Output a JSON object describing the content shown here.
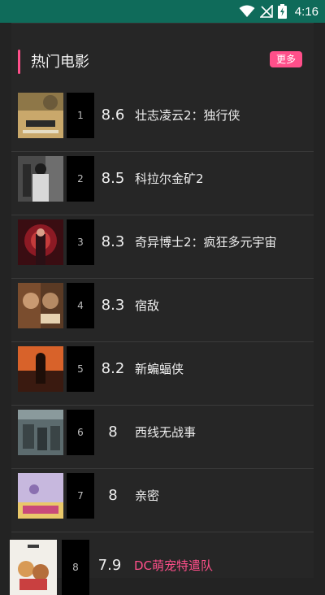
{
  "status_bar": {
    "time": "4:16",
    "icons": [
      "wifi-icon",
      "no-signal-icon",
      "battery-charging-icon"
    ],
    "background": "#0f6b5a"
  },
  "section": {
    "title": "热门电影",
    "more_label": "更多",
    "accent_color": "#ff4f8a"
  },
  "movies": [
    {
      "rank": "1",
      "score": "8.6",
      "title": "壮志凌云2：独行侠"
    },
    {
      "rank": "2",
      "score": "8.5",
      "title": "科拉尔金矿2"
    },
    {
      "rank": "3",
      "score": "8.3",
      "title": "奇异博士2：疯狂多元宇宙"
    },
    {
      "rank": "4",
      "score": "8.3",
      "title": "宿敌"
    },
    {
      "rank": "5",
      "score": "8.2",
      "title": "新蝙蝠侠"
    },
    {
      "rank": "6",
      "score": "8",
      "title": "西线无战事"
    },
    {
      "rank": "7",
      "score": "8",
      "title": "亲密"
    },
    {
      "rank": "8",
      "score": "7.9",
      "title": "DC萌宠特遣队"
    }
  ]
}
